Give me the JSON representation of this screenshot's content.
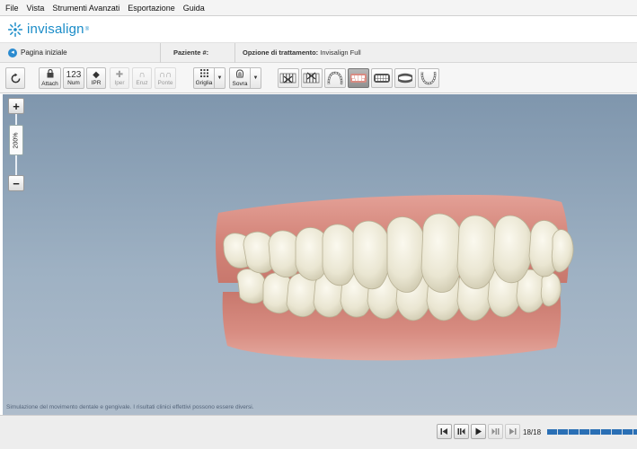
{
  "menu": {
    "items": [
      {
        "label": "File"
      },
      {
        "label": "Vista"
      },
      {
        "label": "Strumenti Avanzati"
      },
      {
        "label": "Esportazione"
      },
      {
        "label": "Guida"
      }
    ]
  },
  "brand": {
    "name": "invisalign",
    "reg": "®",
    "color": "#1a8cc8"
  },
  "info": {
    "home_label": "Pagina iniziale",
    "patient_label": "Paziente #:",
    "treatment_label": "Opzione di trattamento:",
    "treatment_value": "Invisalign Full"
  },
  "toolbar": {
    "attach": "Attach",
    "num_icon": "123",
    "num": "Num",
    "ipr": "IPR",
    "iper": "Iper",
    "eruz": "Eruz",
    "ponte": "Ponte",
    "griglia": "Griglia",
    "sovra": "Sovra"
  },
  "zoom": {
    "level": "200%",
    "fraction": 0.5
  },
  "viewport": {
    "disclaimer": "Simulazione del movimento dentale e gengivale. I risultati clinici effettivi possono essere diversi."
  },
  "playback": {
    "stage": "18/18",
    "progress": 1.0
  },
  "colors": {
    "accent": "#1a8cc8",
    "gum": "#d88a80",
    "tooth": "#ece8d6",
    "progress": "#2a6fb5"
  }
}
